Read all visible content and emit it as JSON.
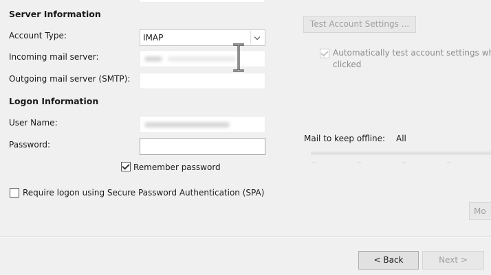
{
  "server_section": {
    "title": "Server Information",
    "account_type_label": "Account Type:",
    "account_type_value": "IMAP",
    "incoming_label": "Incoming mail server:",
    "outgoing_label": "Outgoing mail server (SMTP):"
  },
  "logon_section": {
    "title": "Logon Information",
    "username_label": "User Name:",
    "password_label": "Password:",
    "remember_password_label": "Remember password",
    "spa_label": "Require logon using Secure Password Authentication (SPA)"
  },
  "test_settings": {
    "button_label": "Test Account Settings ...",
    "auto_test_line1": "Automatically test account settings wh",
    "auto_test_line2": "clicked"
  },
  "offline": {
    "label": "Mail to keep offline:",
    "value": "All"
  },
  "more_button_label": "Mo",
  "nav": {
    "back_label": "< Back",
    "next_label": "Next >"
  },
  "checkbox_state": {
    "remember_password": true,
    "spa": false,
    "auto_test": true
  }
}
